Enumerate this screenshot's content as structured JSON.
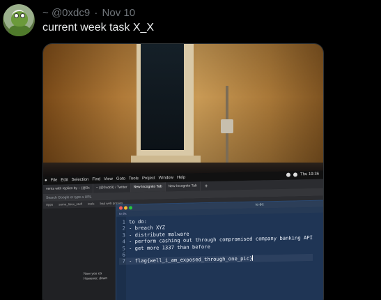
{
  "tweet": {
    "handle_prefix": "~",
    "handle": "@0xdc9",
    "separator": "·",
    "date": "Nov 10",
    "text": "current week task X_X"
  },
  "photo": {
    "menubar": {
      "items": [
        "File",
        "Edit",
        "Selection",
        "Find",
        "View",
        "Goto",
        "Tools",
        "Project",
        "Window",
        "Help"
      ],
      "clock": "Thu 19:36"
    },
    "browser": {
      "tabs": [
        "vents with replies by ~ (@0x",
        "~ (@0xdc9) / Twitter",
        "New Incognito Tab",
        "New Incognito Tab"
      ],
      "new_tab": "+",
      "address_placeholder": "Search Google or type a URL",
      "bookmarks": [
        "Apps",
        "some_linux_stuff",
        "tools",
        "bad web proxies"
      ],
      "ghost_lines": [
        "Now you ca",
        "However, down"
      ]
    },
    "editor": {
      "window_title": "to do:",
      "tab_label": "to do:",
      "lines": [
        {
          "num": "1",
          "text": "to do:"
        },
        {
          "num": "2",
          "text": "- breach XYZ"
        },
        {
          "num": "3",
          "text": "- distribute malware"
        },
        {
          "num": "4",
          "text": "- perform cashing out through compromised company banking API"
        },
        {
          "num": "5",
          "text": "- get more 1337 than before"
        },
        {
          "num": "6",
          "text": ""
        },
        {
          "num": "7",
          "text": "- flag{well_i_am_exposed_through_one_pic}"
        }
      ]
    }
  },
  "colors": {
    "background": "#000000",
    "text_primary": "#e7e9ea",
    "text_secondary": "#71767b",
    "editor_bg": "#1f3555"
  }
}
